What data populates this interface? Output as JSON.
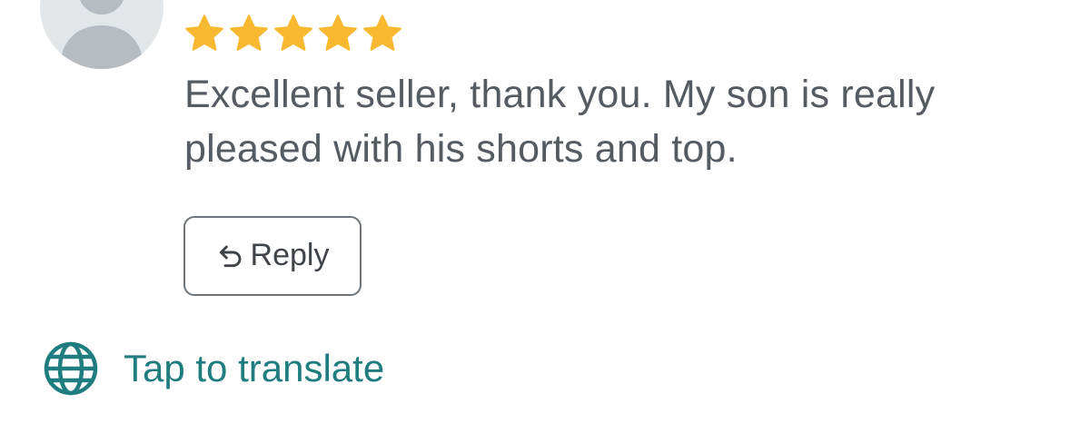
{
  "review": {
    "rating": 5,
    "max_rating": 5,
    "text": "Excellent seller, thank you. My son is really pleased with his shorts and top."
  },
  "actions": {
    "reply_label": "Reply",
    "translate_label": "Tap to translate"
  },
  "colors": {
    "star": "#f8b930",
    "avatar_bg": "#e4e7ea",
    "avatar_figure": "#b7bcc2",
    "text": "#555b63",
    "link": "#1f7d80",
    "button_border": "#6e747b"
  },
  "icons": {
    "avatar": "default-user-silhouette",
    "star": "filled-star",
    "reply": "reply-arrow",
    "translate": "globe"
  }
}
